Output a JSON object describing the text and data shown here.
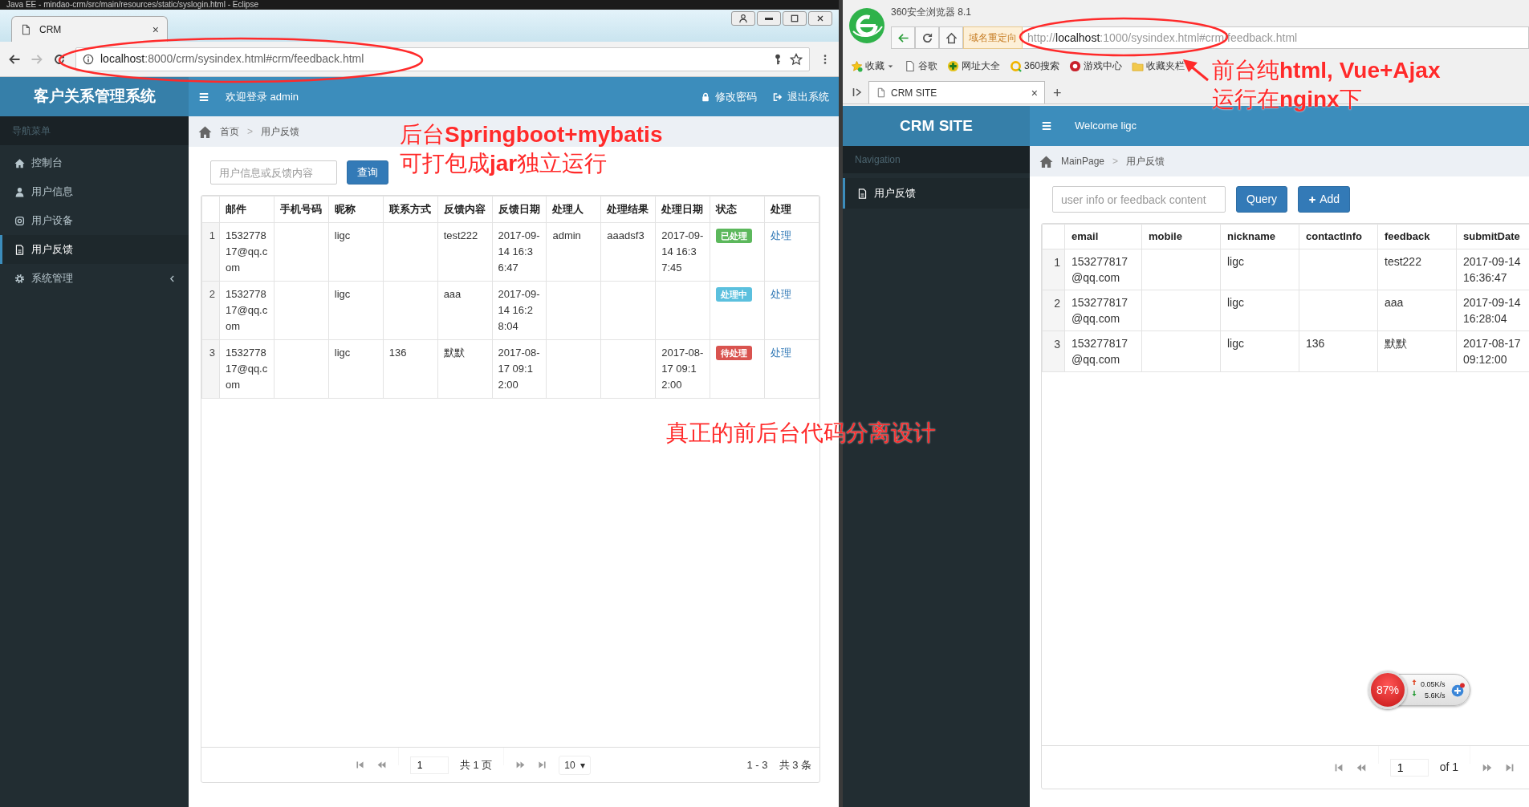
{
  "eclipse": {
    "title": "Java EE - mindao-crm/src/main/resources/static/syslogin.html - Eclipse"
  },
  "left_browser": {
    "tab": {
      "title": "CRM",
      "close": "×"
    },
    "address": {
      "host": "localhost",
      "path": ":8000/crm/sysindex.html#crm/feedback.html"
    },
    "app": {
      "brand": "客户关系管理系统",
      "welcome": "欢迎登录 admin",
      "header_links": [
        "修改密码",
        "退出系统"
      ],
      "sidebar": {
        "heading": "导航菜单",
        "items": [
          {
            "label": "控制台",
            "kind": "link",
            "selected": false
          },
          {
            "label": "用户信息",
            "kind": "link",
            "selected": false
          },
          {
            "label": "用户设备",
            "kind": "link",
            "selected": false
          },
          {
            "label": "用户反馈",
            "kind": "link",
            "selected": true
          },
          {
            "label": "系统管理",
            "kind": "group",
            "selected": false
          }
        ]
      },
      "breadcrumb": {
        "items": [
          "首页",
          "用户反馈"
        ],
        "separator": ">"
      },
      "search": {
        "placeholder": "用户信息或反馈内容",
        "button": "查询"
      },
      "table": {
        "columns": [
          "邮件",
          "手机号码",
          "昵称",
          "联系方式",
          "反馈内容",
          "反馈日期",
          "处理人",
          "处理结果",
          "处理日期",
          "状态",
          "处理"
        ],
        "rows": [
          {
            "index": "1",
            "email": "153277817@qq.com",
            "nickname": "ligc",
            "feedback": "test222",
            "submit_date": "2017-09-14 16:36:47",
            "handler": "admin",
            "result": "aaadsf3",
            "handled_date": "2017-09-14 16:37:45",
            "status": {
              "label": "已处理",
              "color": "#5cb85c"
            },
            "action": "处理"
          },
          {
            "index": "2",
            "email": "153277817@qq.com",
            "nickname": "ligc",
            "feedback": "aaa",
            "submit_date": "2017-09-14 16:28:04",
            "status": {
              "label": "处理中",
              "color": "#5bc0de"
            },
            "action": "处理"
          },
          {
            "index": "3",
            "email": "153277817@qq.com",
            "nickname": "ligc",
            "contact": "136",
            "feedback": "默默",
            "submit_date": "2017-08-17 09:12:00",
            "handled_date": "2017-08-17 09:12:00",
            "status": {
              "label": "待处理",
              "color": "#d9534f"
            },
            "action": "处理"
          }
        ]
      },
      "pager": {
        "page": "1",
        "pages": "共 1 页",
        "size": "10",
        "caret": "▾",
        "range": "1 - 3",
        "total": "共 3 条"
      }
    }
  },
  "right_browser": {
    "title": "360安全浏览器 8.1",
    "redirect_tag": "域名重定向",
    "address": {
      "scheme": "http://",
      "host": "localhost",
      "path": ":1000/sysindex.html#crm/feedback.html"
    },
    "bookmarks": [
      {
        "label": "收藏",
        "kind": "favorites"
      },
      {
        "label": "谷歌",
        "kind": "page"
      },
      {
        "label": "网址大全",
        "kind": "navi"
      },
      {
        "label": "360搜索",
        "kind": "search"
      },
      {
        "label": "游戏中心",
        "kind": "game"
      },
      {
        "label": "收藏夹栏",
        "kind": "folder"
      }
    ],
    "tab": {
      "title": "CRM SITE",
      "close": "×",
      "new": "+"
    },
    "app": {
      "brand": "CRM SITE",
      "welcome": "Welcome ligc",
      "sidebar": {
        "heading": "Navigation",
        "items": [
          {
            "label": "用户反馈",
            "selected": true
          }
        ]
      },
      "breadcrumb": {
        "items": [
          "MainPage",
          "用户反馈"
        ],
        "separator": ">"
      },
      "search": {
        "placeholder": "user info or feedback content",
        "buttons": [
          {
            "label": "Query",
            "kind": "query"
          },
          {
            "label": "Add",
            "kind": "add"
          }
        ]
      },
      "table": {
        "columns": [
          "email",
          "mobile",
          "nickname",
          "contactInfo",
          "feedback",
          "submitDate"
        ],
        "rows": [
          {
            "index": "1",
            "email": "153277817@qq.com",
            "nickname": "ligc",
            "feedback": "test222",
            "submit_date": "2017-09-14 16:36:47"
          },
          {
            "index": "2",
            "email": "153277817@qq.com",
            "nickname": "ligc",
            "feedback": "aaa",
            "submit_date": "2017-09-14 16:28:04"
          },
          {
            "index": "3",
            "email": "153277817@qq.com",
            "nickname": "ligc",
            "contact": "136",
            "feedback": "默默",
            "submit_date": "2017-08-17 09:12:00"
          }
        ]
      },
      "pager": {
        "page": "1",
        "pages": "of 1"
      }
    }
  },
  "speed_widget": {
    "percent": "87%",
    "upload": "0.05K/s",
    "download": "5.6K/s"
  },
  "annotations": [
    {
      "lines": [
        "后台**Springboot+mybatis**",
        "可打包成**jar**独立运行"
      ]
    },
    {
      "lines": [
        "真正的前后台代码分离设计"
      ]
    },
    {
      "lines": [
        "前台纯**html, Vue+Ajax**",
        "运行在**nginx**下"
      ]
    }
  ]
}
